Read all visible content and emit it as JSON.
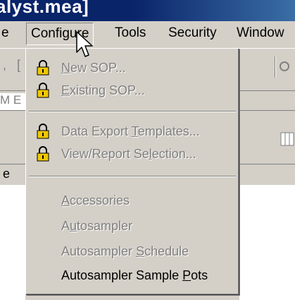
{
  "window": {
    "title_fragment": "alyst.mea]"
  },
  "menubar": {
    "items": [
      {
        "id": "file_fragment",
        "label": "e"
      },
      {
        "id": "configure",
        "label": "Configure",
        "open": true
      },
      {
        "id": "tools",
        "label": "Tools"
      },
      {
        "id": "security",
        "label": "Security"
      },
      {
        "id": "window_fragment",
        "label": "Window"
      }
    ]
  },
  "background": {
    "fragments": [
      ",",
      "[",
      "M E",
      "e"
    ]
  },
  "configure_menu": {
    "items": [
      {
        "label_pre": "",
        "underline": "N",
        "label_post": "ew SOP...",
        "enabled": false,
        "icon": "lock-icon"
      },
      {
        "label_pre": "",
        "underline": "E",
        "label_post": "xisting SOP...",
        "enabled": false,
        "icon": "lock-icon"
      },
      {
        "label_pre": "Data Export ",
        "underline": "T",
        "label_post": "emplates...",
        "enabled": false,
        "icon": "lock-icon"
      },
      {
        "label_pre": "View/Report Se",
        "underline": "l",
        "label_post": "ection...",
        "enabled": false,
        "icon": "lock-icon"
      },
      {
        "label_pre": "",
        "underline": "A",
        "label_post": "ccessories",
        "enabled": false
      },
      {
        "label_pre": "A",
        "underline": "u",
        "label_post": "tosampler",
        "enabled": false
      },
      {
        "label_pre": "Autosampler ",
        "underline": "S",
        "label_post": "chedule",
        "enabled": false
      },
      {
        "label_pre": "Autosampler Sample ",
        "underline": "P",
        "label_post": "ots",
        "enabled": true
      }
    ]
  },
  "colors": {
    "menu_bg": "#d4d0c8",
    "disabled_text": "#808080",
    "lock_body": "#f0c800",
    "titlebar": "#0a246a"
  }
}
